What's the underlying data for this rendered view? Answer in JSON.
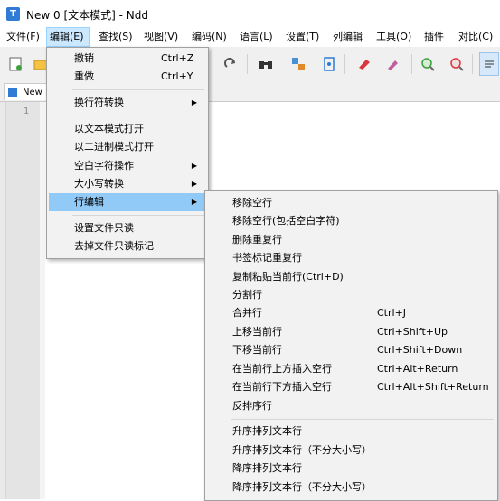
{
  "window": {
    "title": "New 0 [文本模式] - Ndd",
    "icon_letter": "T"
  },
  "menubar": {
    "file": "文件(F)",
    "edit": "编辑(E)",
    "search": "查找(S)",
    "view": "视图(V)",
    "encoding": "编码(N)",
    "language": "语言(L)",
    "settings": "设置(T)",
    "column_edit": "列编辑",
    "tools": "工具(O)",
    "plugins": "插件",
    "compare": "对比(C)"
  },
  "tab": {
    "label": "New"
  },
  "editor": {
    "line_number": "1"
  },
  "edit_menu": {
    "undo": {
      "label": "撤销",
      "shortcut": "Ctrl+Z"
    },
    "redo": {
      "label": "重做",
      "shortcut": "Ctrl+Y"
    },
    "eol_convert": {
      "label": "换行符转换"
    },
    "open_text_mode": {
      "label": "以文本模式打开"
    },
    "open_binary_mode": {
      "label": "以二进制模式打开"
    },
    "whitespace_ops": {
      "label": "空白字符操作"
    },
    "case_convert": {
      "label": "大小写转换"
    },
    "line_edit": {
      "label": "行编辑"
    },
    "set_readonly": {
      "label": "设置文件只读"
    },
    "remove_readonly": {
      "label": "去掉文件只读标记"
    }
  },
  "line_edit_submenu": {
    "remove_empty": {
      "label": "移除空行"
    },
    "remove_empty_ws": {
      "label": "移除空行(包括空白字符)"
    },
    "remove_duplicates": {
      "label": "删除重复行"
    },
    "bookmark_duplicates": {
      "label": "书签标记重复行"
    },
    "duplicate_line": {
      "label": "复制粘贴当前行(Ctrl+D)"
    },
    "split_lines": {
      "label": "分割行"
    },
    "join_lines": {
      "label": "合并行",
      "shortcut": "Ctrl+J"
    },
    "move_up": {
      "label": "上移当前行",
      "shortcut": "Ctrl+Shift+Up"
    },
    "move_down": {
      "label": "下移当前行",
      "shortcut": "Ctrl+Shift+Down"
    },
    "insert_above": {
      "label": "在当前行上方插入空行",
      "shortcut": "Ctrl+Alt+Return"
    },
    "insert_below": {
      "label": "在当前行下方插入空行",
      "shortcut": "Ctrl+Alt+Shift+Return"
    },
    "reverse": {
      "label": "反排序行"
    },
    "sort_asc": {
      "label": "升序排列文本行"
    },
    "sort_asc_ci": {
      "label": "升序排列文本行（不分大小写）"
    },
    "sort_desc": {
      "label": "降序排列文本行"
    },
    "sort_desc_ci": {
      "label": "降序排列文本行（不分大小写）"
    }
  },
  "colors": {
    "highlight": "#91c9f7",
    "menu_active": "#cce8ff",
    "menu_bg": "#f2f2f2"
  }
}
